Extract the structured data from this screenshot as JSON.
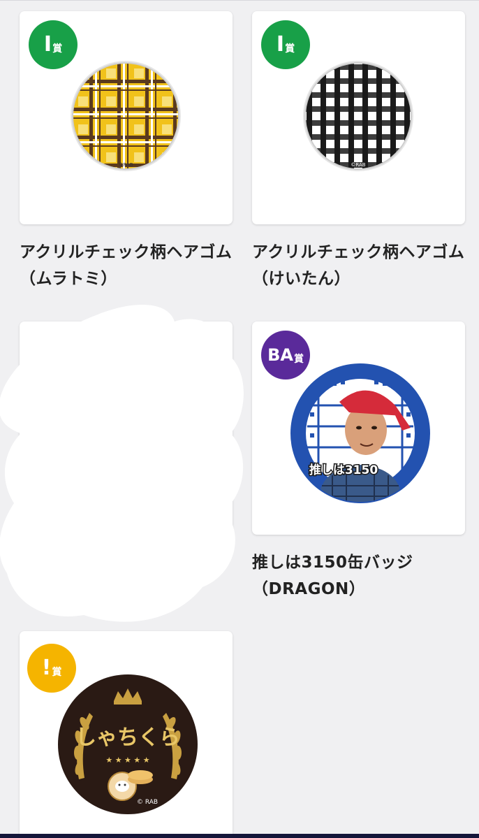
{
  "items": [
    {
      "badge_main": "I",
      "badge_suffix": "賞",
      "badge_color": "#18a048",
      "title": "アクリルチェック柄ヘアゴム（ムラトミ）",
      "image": "yellow-check-hair-tie",
      "copyright": "©RAB"
    },
    {
      "badge_main": "I",
      "badge_suffix": "賞",
      "badge_color": "#18a048",
      "title": "アクリルチェック柄ヘアゴム（けいたん）",
      "image": "black-gingham-hair-tie",
      "copyright": "©RAB"
    },
    {
      "badge_main": "BA",
      "badge_suffix": "賞",
      "badge_color": "#5a2a9a",
      "title": "推しは3150缶バッジ（DRAGON）",
      "image": "dragon-can-badge",
      "badge_text": "推しは3150"
    },
    {
      "badge_main": "!",
      "badge_suffix": "賞",
      "badge_color": "#f5b400",
      "title": "",
      "image": "shachikura-badge",
      "logo_text": "しゃちくら",
      "copyright": "© RAB"
    }
  ],
  "colors": {
    "background": "#f0f0f2",
    "card": "#ffffff",
    "bottom_bar": "#14163a"
  }
}
